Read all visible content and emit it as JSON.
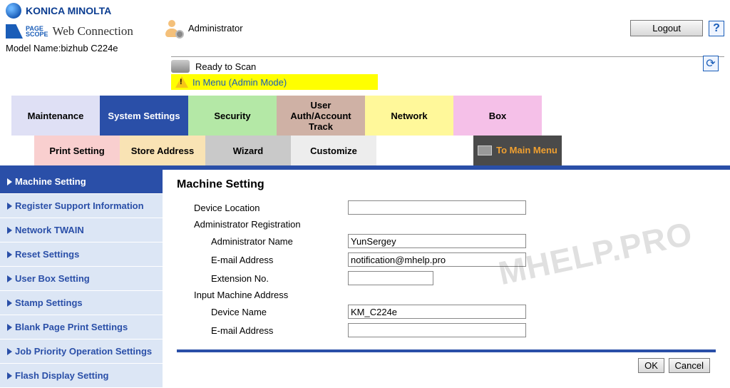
{
  "header": {
    "brand": "KONICA MINOLTA",
    "pagescope1": "PAGE",
    "pagescope2": "SCOPE",
    "webconn": "Web Connection",
    "model_label": "Model Name:",
    "model_value": "bizhub C224e",
    "admin_label": "Administrator",
    "logout": "Logout",
    "help": "?",
    "status_ready": "Ready to Scan",
    "status_menu": "In Menu (Admin Mode)",
    "refresh": "⟳"
  },
  "tabs": {
    "maint": "Maintenance",
    "sys": "System Settings",
    "sec": "Security",
    "user": "User Auth/Account Track",
    "net": "Network",
    "box": "Box"
  },
  "subtabs": {
    "print": "Print Setting",
    "store": "Store Address",
    "wiz": "Wizard",
    "cust": "Customize",
    "main": "To Main Menu"
  },
  "sidebar": [
    "Machine Setting",
    "Register Support Information",
    "Network TWAIN",
    "Reset Settings",
    "User Box Setting",
    "Stamp Settings",
    "Blank Page Print Settings",
    "Job Priority Operation Settings",
    "Flash Display Setting"
  ],
  "form": {
    "title": "Machine Setting",
    "device_location": "Device Location",
    "admin_reg": "Administrator Registration",
    "admin_name": "Administrator Name",
    "email": "E-mail Address",
    "ext_no": "Extension No.",
    "input_machine": "Input Machine Address",
    "device_name": "Device Name",
    "email2": "E-mail Address",
    "values": {
      "device_location": "",
      "admin_name": "YunSergey",
      "email": "notification@mhelp.pro",
      "ext_no": "",
      "device_name": "KM_C224e",
      "email2": ""
    },
    "ok": "OK",
    "cancel": "Cancel"
  },
  "watermark": "MHELP.PRO"
}
